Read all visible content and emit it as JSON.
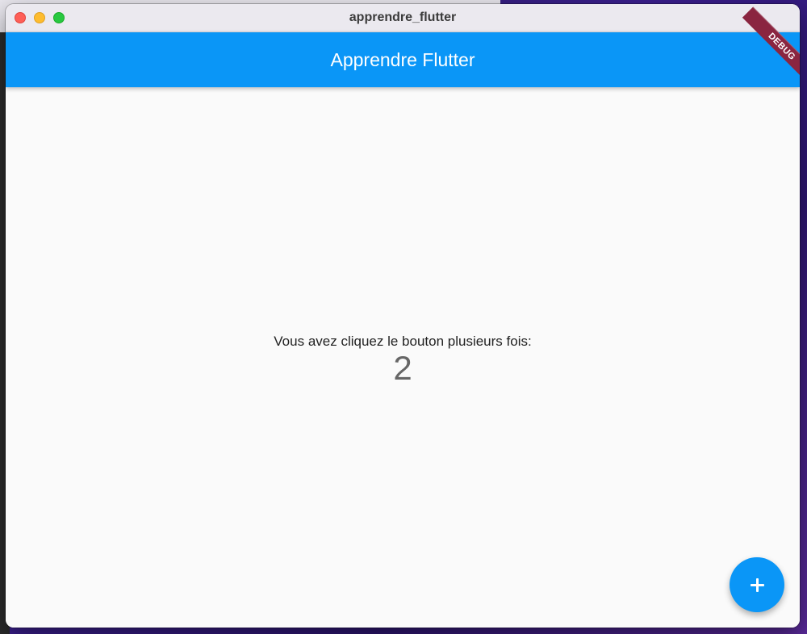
{
  "window": {
    "title": "apprendre_flutter"
  },
  "appbar": {
    "title": "Apprendre Flutter",
    "color": "#0a96f7"
  },
  "debug_banner": {
    "label": "DEBUG",
    "color": "#8a2540"
  },
  "body": {
    "counter_label": "Vous avez cliquez le bouton plusieurs fois:",
    "counter_value": "2"
  },
  "fab": {
    "icon": "plus-icon",
    "color": "#0a96f7"
  }
}
